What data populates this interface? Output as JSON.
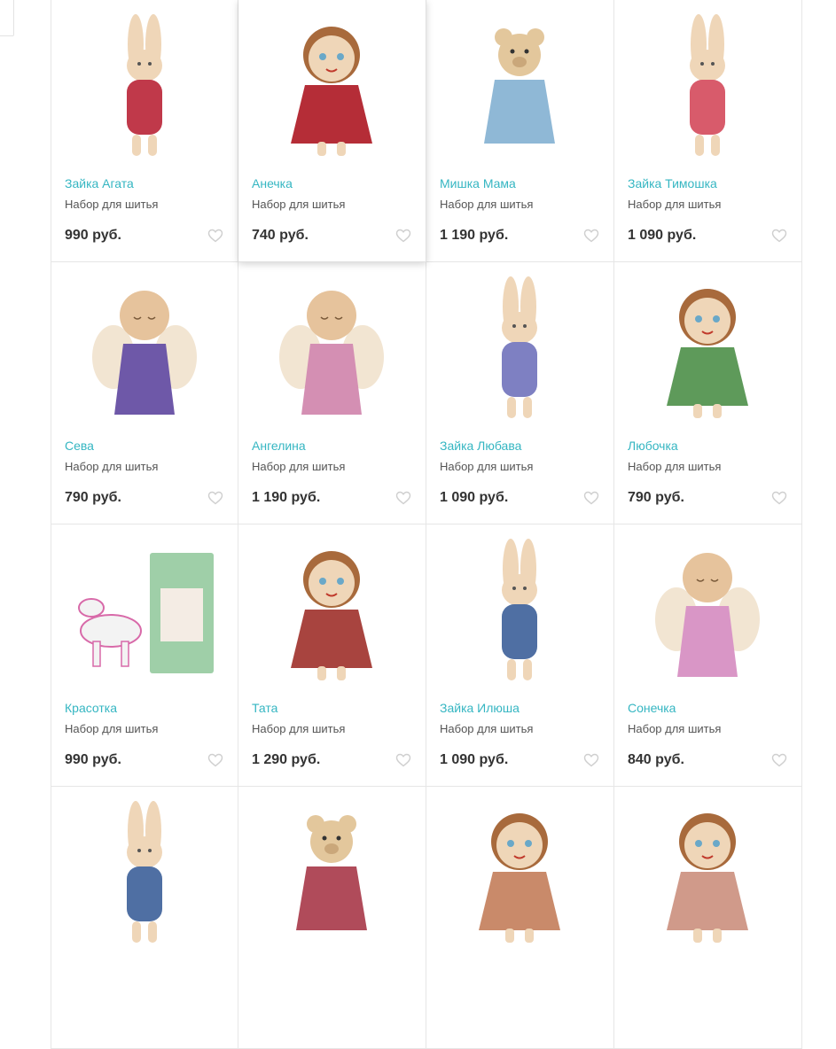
{
  "products": [
    {
      "name": "Зайка Агата",
      "subtitle": "Набор для шитья",
      "price": "990 руб.",
      "image_icon": "bunny-doll-icon",
      "dress": "#c0394a"
    },
    {
      "name": "Анечка",
      "subtitle": "Набор для шитья",
      "price": "740 руб.",
      "image_icon": "girl-doll-icon",
      "dress": "#b52d37"
    },
    {
      "name": "Мишка Мама",
      "subtitle": "Набор для шитья",
      "price": "1 190 руб.",
      "image_icon": "bear-doll-icon",
      "dress": "#8fb8d6"
    },
    {
      "name": "Зайка Тимошка",
      "subtitle": "Набор для шитья",
      "price": "1 090 руб.",
      "image_icon": "bunny-doll-icon",
      "dress": "#d85b6b"
    },
    {
      "name": "Сева",
      "subtitle": "Набор для шитья",
      "price": "790 руб.",
      "image_icon": "angel-doll-icon",
      "dress": "#6e58a8"
    },
    {
      "name": "Ангелина",
      "subtitle": "Набор для шитья",
      "price": "1 190 руб.",
      "image_icon": "angel-doll-icon",
      "dress": "#d48fb3"
    },
    {
      "name": "Зайка Любава",
      "subtitle": "Набор для шитья",
      "price": "1 090 руб.",
      "image_icon": "bunny-doll-icon",
      "dress": "#7e80c2"
    },
    {
      "name": "Любочка",
      "subtitle": "Набор для шитья",
      "price": "790 руб.",
      "image_icon": "girl-doll-icon",
      "dress": "#5e9a5a"
    },
    {
      "name": "Красотка",
      "subtitle": "Набор для шитья",
      "price": "990 руб.",
      "image_icon": "horse-kit-icon",
      "dress": "#d86aa9"
    },
    {
      "name": "Тата",
      "subtitle": "Набор для шитья",
      "price": "1 290 руб.",
      "image_icon": "girl-doll-icon",
      "dress": "#a8443f"
    },
    {
      "name": "Зайка Илюша",
      "subtitle": "Набор для шитья",
      "price": "1 090 руб.",
      "image_icon": "bunny-doll-icon",
      "dress": "#4f6fa3"
    },
    {
      "name": "Сонечка",
      "subtitle": "Набор для шитья",
      "price": "840 руб.",
      "image_icon": "angel-doll-icon",
      "dress": "#d996c6"
    },
    {
      "name": "",
      "subtitle": "",
      "price": "",
      "image_icon": "bunny-doll-icon",
      "dress": "#4f6fa3"
    },
    {
      "name": "",
      "subtitle": "",
      "price": "",
      "image_icon": "bear-doll-icon",
      "dress": "#b04b5a"
    },
    {
      "name": "",
      "subtitle": "",
      "price": "",
      "image_icon": "girl-doll-icon",
      "dress": "#c98a6a"
    },
    {
      "name": "",
      "subtitle": "",
      "price": "",
      "image_icon": "girl-doll-icon",
      "dress": "#d09a8a"
    }
  ],
  "hovered_index": 1,
  "favorite_icon": "heart-outline-icon",
  "colors": {
    "link": "#35b6c2",
    "price": "#333333",
    "heart": "#cfcfcf",
    "border": "#e6e6e6"
  }
}
